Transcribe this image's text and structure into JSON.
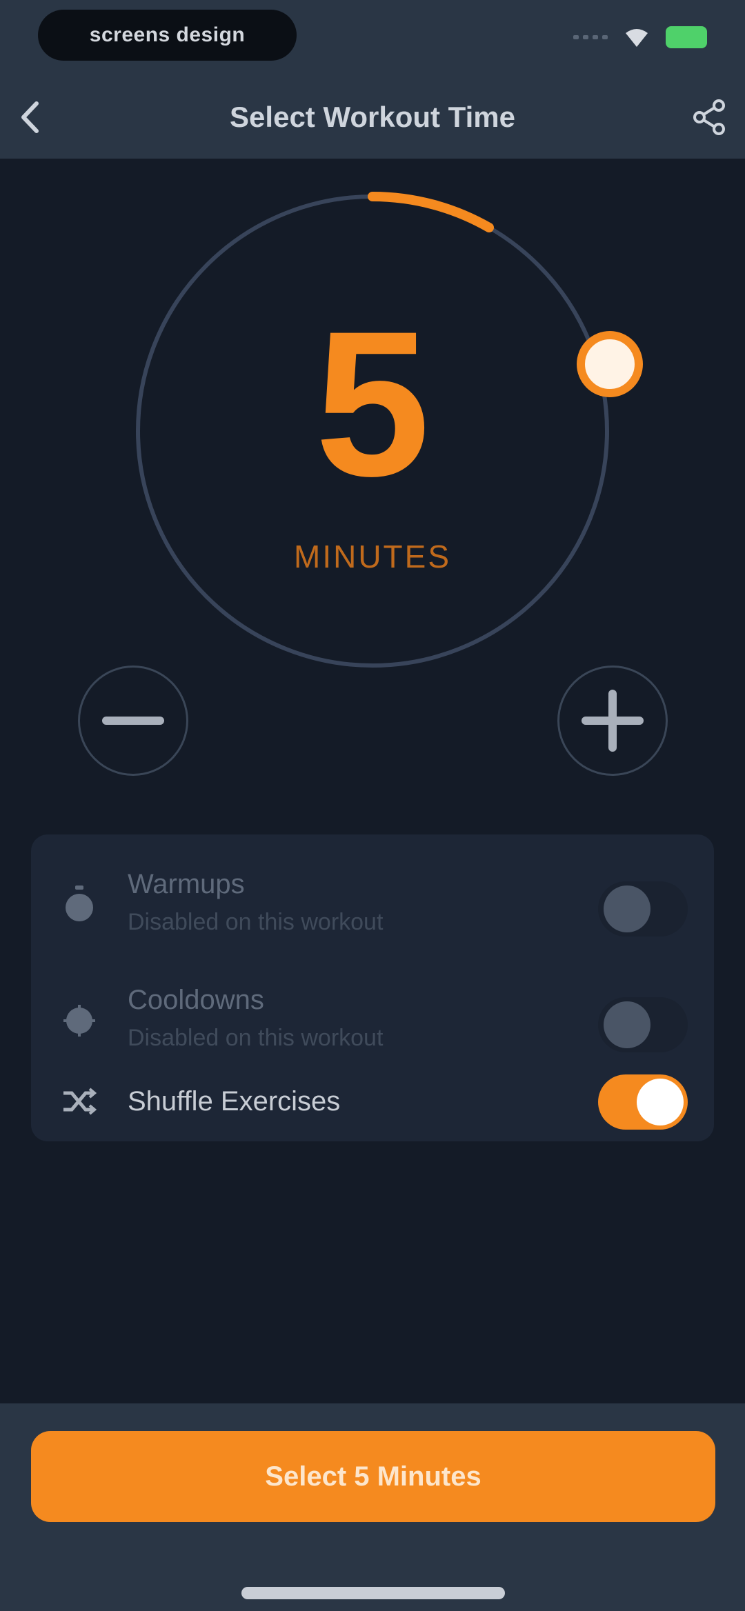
{
  "status_bar": {
    "pill_text": "screens design"
  },
  "nav": {
    "title": "Select Workout Time"
  },
  "timer": {
    "value": "5",
    "unit": "MINUTES",
    "progress_fraction": 0.083
  },
  "options": [
    {
      "title": "Warmups",
      "subtitle": "Disabled on this workout",
      "enabled": false,
      "icon": "stopwatch-icon"
    },
    {
      "title": "Cooldowns",
      "subtitle": "Disabled on this workout",
      "enabled": false,
      "icon": "snowflake-icon"
    },
    {
      "title": "Shuffle Exercises",
      "subtitle": "",
      "enabled": true,
      "icon": "shuffle-icon"
    }
  ],
  "cta": {
    "label": "Select 5 Minutes"
  },
  "colors": {
    "accent": "#f58a1f",
    "background": "#141b27",
    "bar": "#2a3645",
    "card": "#1d2636"
  }
}
